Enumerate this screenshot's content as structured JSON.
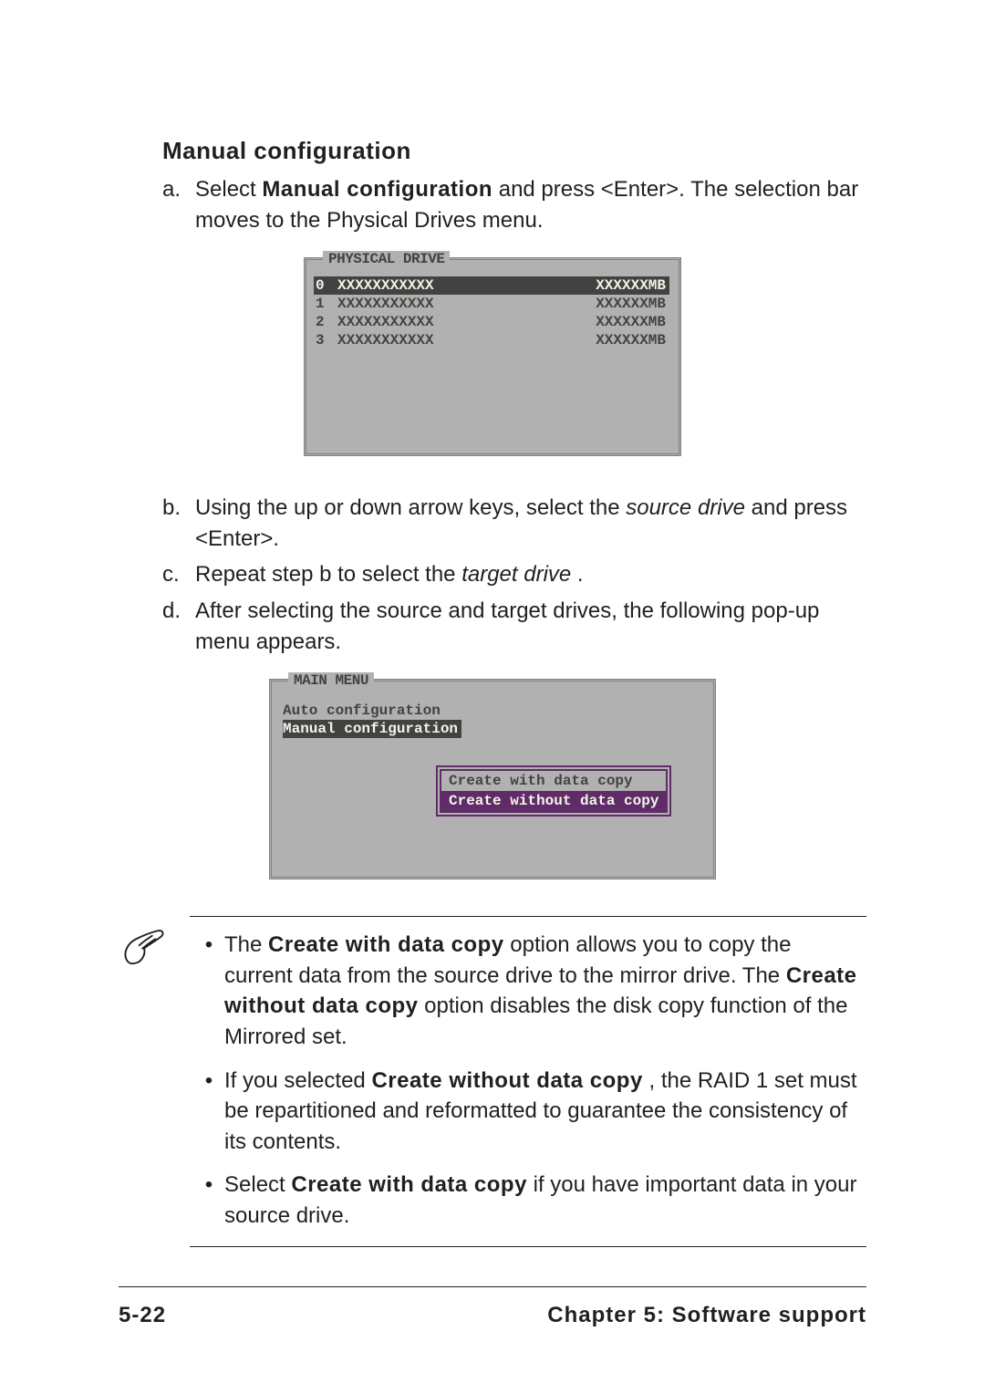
{
  "heading": "Manual configuration",
  "steps": {
    "a": {
      "marker": "a.",
      "pre": "Select ",
      "bold1": "Manual configuration",
      "post": " and press <Enter>. The selection bar moves to the Physical Drives menu."
    },
    "b": {
      "marker": "b.",
      "pre": "Using the up or down arrow keys, select the ",
      "ital": "source drive",
      "post": " and press <Enter>."
    },
    "c": {
      "marker": "c.",
      "pre": "Repeat step b to select the ",
      "ital": "target drive",
      "post": "."
    },
    "d": {
      "marker": "d.",
      "text": "After selecting the source and target drives, the following pop-up menu appears."
    }
  },
  "physical_panel": {
    "title": "PHYSICAL DRIVE",
    "rows": [
      {
        "num": "0",
        "name": "XXXXXXXXXXX",
        "size": "XXXXXXMB",
        "selected": true
      },
      {
        "num": "1",
        "name": "XXXXXXXXXXX",
        "size": "XXXXXXMB",
        "selected": false
      },
      {
        "num": "2",
        "name": "XXXXXXXXXXX",
        "size": "XXXXXXMB",
        "selected": false
      },
      {
        "num": "3",
        "name": "XXXXXXXXXXX",
        "size": "XXXXXXMB",
        "selected": false
      }
    ]
  },
  "main_menu": {
    "title": "MAIN MENU",
    "items": [
      {
        "label": "Auto configuration",
        "selected": false
      },
      {
        "label": "Manual configuration",
        "selected": true
      }
    ],
    "popup": [
      {
        "label": "Create with data copy",
        "selected": false
      },
      {
        "label": "Create without data copy",
        "selected": true
      }
    ]
  },
  "notes": {
    "n1": {
      "pre": "The ",
      "b1": "Create with data copy",
      "mid1": " option allows you to copy the current data from the source drive to the mirror drive. The ",
      "b2": "Create without data copy",
      "post": " option disables the disk copy function of the Mirrored set."
    },
    "n2": {
      "pre": "If you selected ",
      "b1": "Create without data copy",
      "post": " , the RAID 1 set must be repartitioned and reformatted to guarantee the consistency of its contents."
    },
    "n3": {
      "pre": "Select ",
      "b1": "Create with data copy",
      "post": " if you have important data in your source drive."
    }
  },
  "footer": {
    "page": "5-22",
    "chapter": "Chapter 5: Software support"
  }
}
